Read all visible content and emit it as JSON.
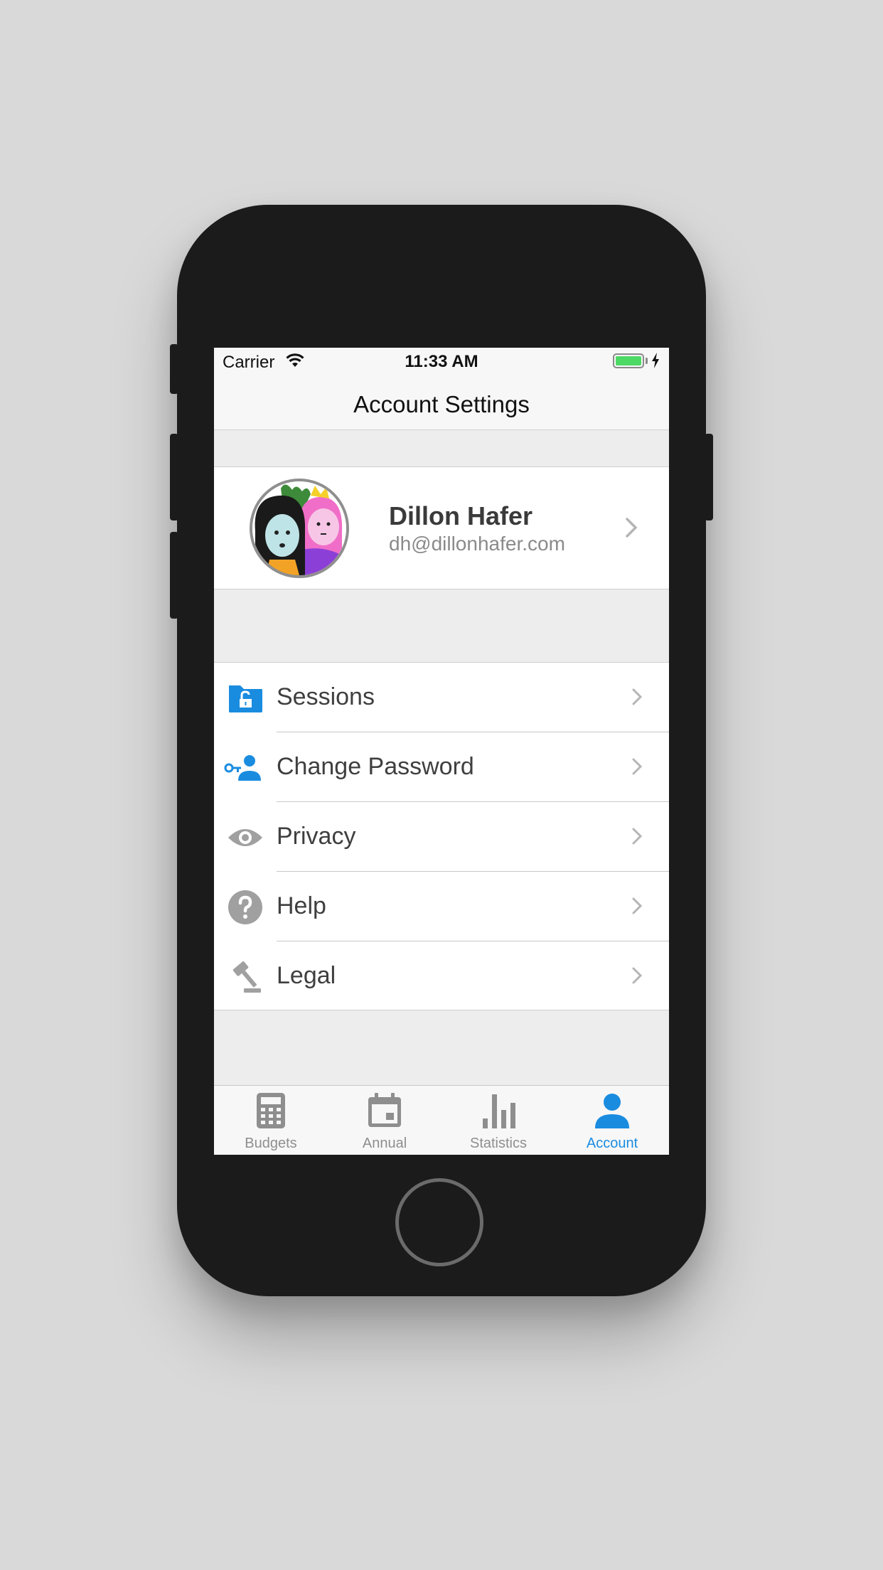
{
  "status_bar": {
    "carrier": "Carrier",
    "time": "11:33 AM"
  },
  "nav": {
    "title": "Account Settings"
  },
  "profile": {
    "name": "Dillon Hafer",
    "email": "dh@dillonhafer.com"
  },
  "menu": [
    {
      "label": "Sessions",
      "icon": "folder-unlock-icon",
      "icon_color": "#1a8ce0"
    },
    {
      "label": "Change Password",
      "icon": "person-key-icon",
      "icon_color": "#1a8ce0"
    },
    {
      "label": "Privacy",
      "icon": "eye-icon",
      "icon_color": "#a0a0a0"
    },
    {
      "label": "Help",
      "icon": "question-circle-icon",
      "icon_color": "#a0a0a0"
    },
    {
      "label": "Legal",
      "icon": "gavel-icon",
      "icon_color": "#a0a0a0"
    }
  ],
  "tabs": [
    {
      "label": "Budgets",
      "icon": "calculator-icon",
      "active": false
    },
    {
      "label": "Annual",
      "icon": "calendar-icon",
      "active": false
    },
    {
      "label": "Statistics",
      "icon": "bar-chart-icon",
      "active": false
    },
    {
      "label": "Account",
      "icon": "person-icon",
      "active": true
    }
  ],
  "colors": {
    "accent": "#1a8ce0",
    "inactive": "#8e8e8e",
    "battery": "#4cd964"
  }
}
